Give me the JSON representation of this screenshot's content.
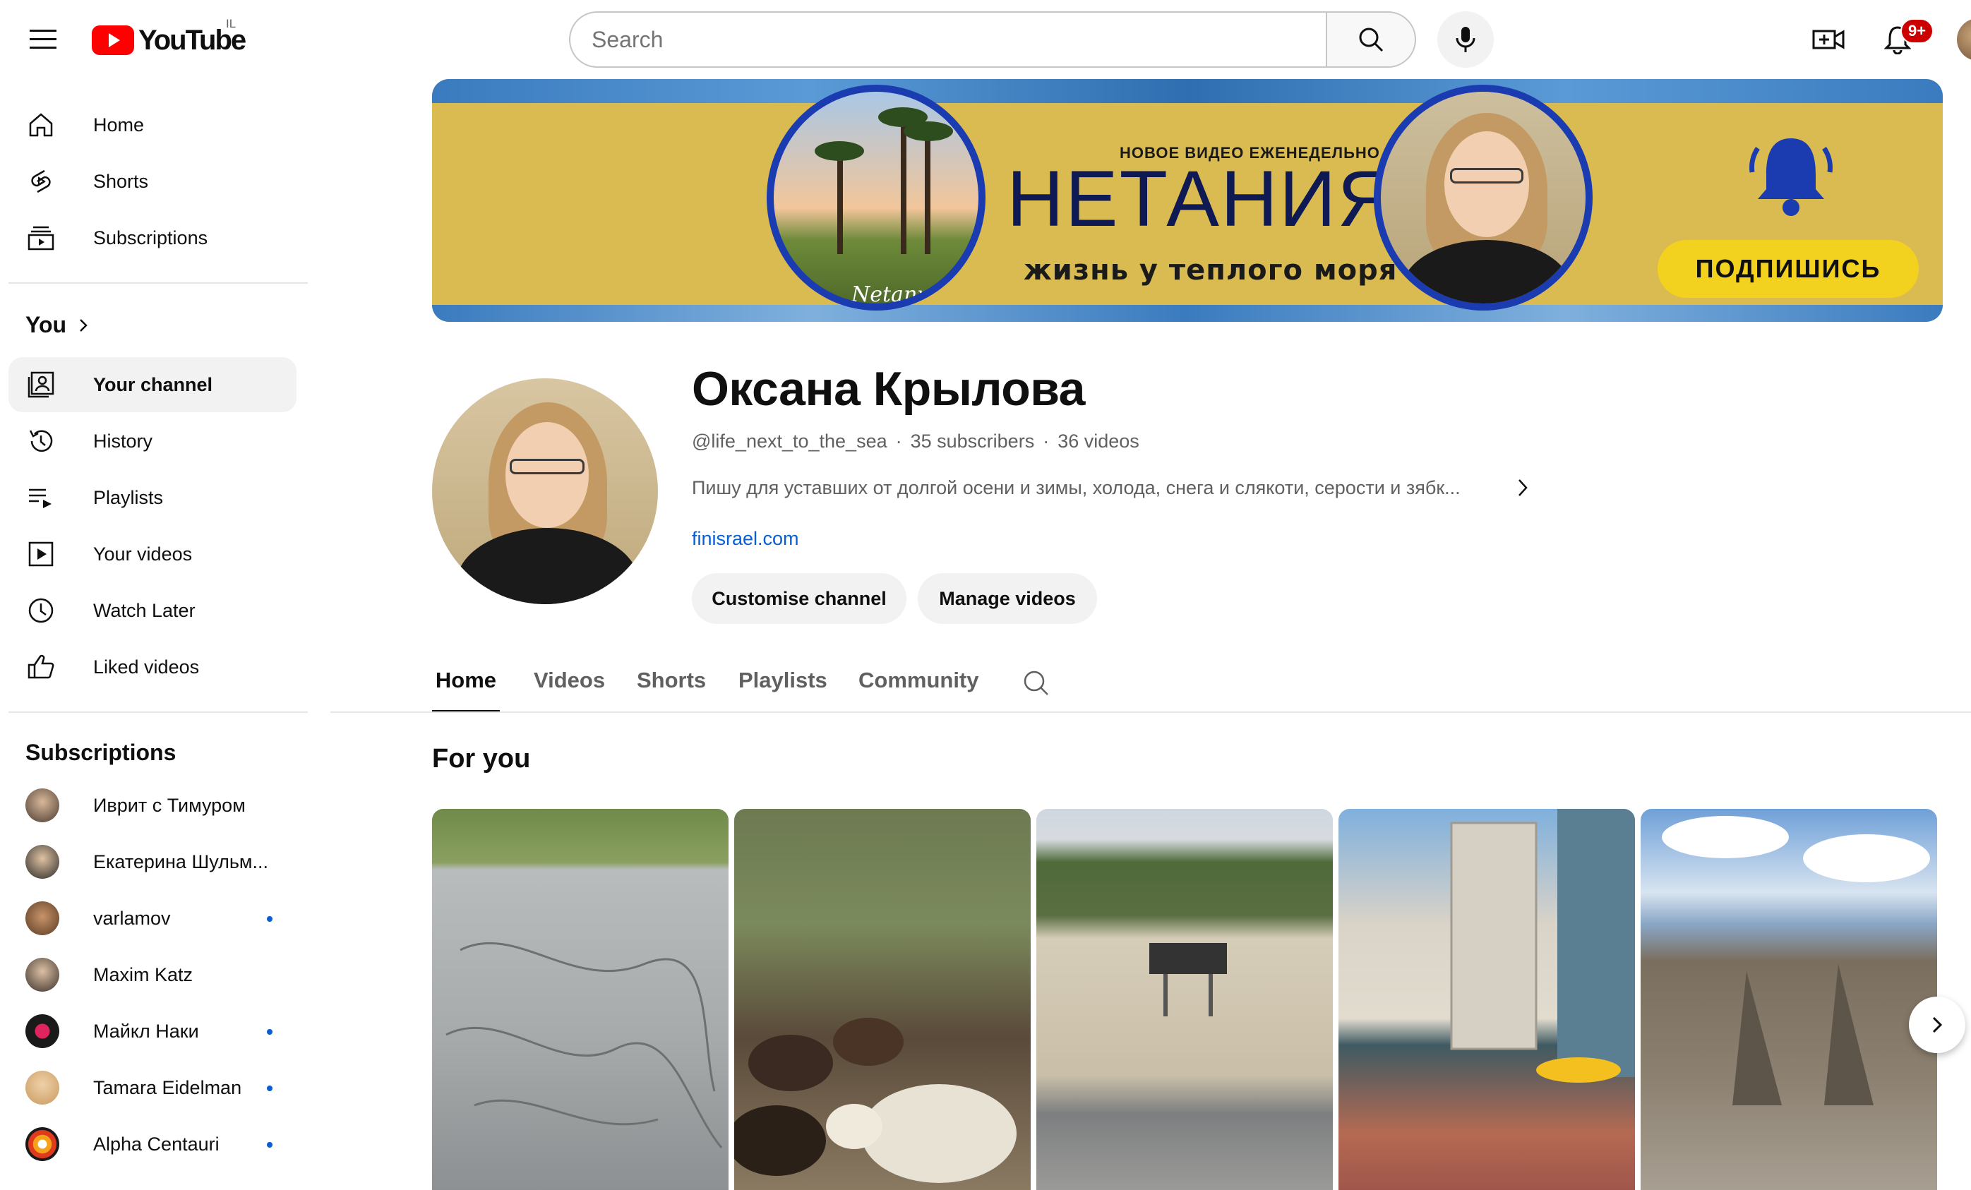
{
  "topbar": {
    "logo_text": "YouTube",
    "region": "IL",
    "search_placeholder": "Search",
    "notifications_badge": "9+"
  },
  "sidebar": {
    "main": [
      {
        "label": "Home",
        "icon": "home-icon"
      },
      {
        "label": "Shorts",
        "icon": "shorts-icon"
      },
      {
        "label": "Subscriptions",
        "icon": "subscriptions-icon"
      }
    ],
    "you_title": "You",
    "you_items": [
      {
        "label": "Your channel",
        "icon": "your-channel-icon",
        "active": true
      },
      {
        "label": "History",
        "icon": "history-icon"
      },
      {
        "label": "Playlists",
        "icon": "playlists-icon"
      },
      {
        "label": "Your videos",
        "icon": "your-videos-icon"
      },
      {
        "label": "Watch Later",
        "icon": "watch-later-icon"
      },
      {
        "label": "Liked videos",
        "icon": "liked-videos-icon"
      }
    ],
    "subscriptions_title": "Subscriptions",
    "subscriptions": [
      {
        "label": "Иврит с Тимуром",
        "new": false
      },
      {
        "label": "Екатерина Шульм...",
        "new": false
      },
      {
        "label": "varlamov",
        "new": true
      },
      {
        "label": "Maxim Katz",
        "new": false
      },
      {
        "label": "Майкл Наки",
        "new": true
      },
      {
        "label": "Tamara Eidelman",
        "new": true
      },
      {
        "label": "Alpha Centauri",
        "new": true
      }
    ]
  },
  "banner": {
    "small_text": "НОВОЕ ВИДЕО ЕЖЕНЕДЕЛЬНО",
    "big_text": "НЕТАНИЯ",
    "tagline": "жизнь у теплого моря",
    "signature": "Netanya",
    "button": "ПОДПИШИСЬ"
  },
  "channel": {
    "name": "Оксана Крылова",
    "handle": "@life_next_to_the_sea",
    "subscribers": "35 subscribers",
    "videos": "36 videos",
    "separator": "·",
    "description": "Пишу для уставших от долгой осени и зимы, холода, снега и слякоти, серости и зябк...",
    "link": "finisrael.com",
    "customise_button": "Customise channel",
    "manage_button": "Manage videos"
  },
  "tabs": [
    {
      "label": "Home",
      "active": true
    },
    {
      "label": "Videos"
    },
    {
      "label": "Shorts"
    },
    {
      "label": "Playlists"
    },
    {
      "label": "Community"
    }
  ],
  "section": {
    "for_you": "For you"
  },
  "colors": {
    "brand_red": "#ff0000",
    "link_blue": "#065fd4",
    "banner_yellow": "#d9bb52",
    "banner_blue": "#1b3bb0"
  }
}
